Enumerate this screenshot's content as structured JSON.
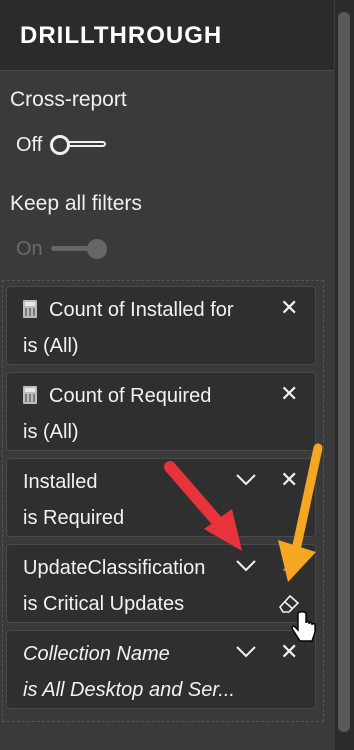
{
  "panel": {
    "title": "DRILLTHROUGH",
    "cross_report": {
      "label": "Cross-report",
      "toggle_text": "Off",
      "state": "off"
    },
    "keep_all_filters": {
      "label": "Keep all filters",
      "toggle_text": "On",
      "state": "on-disabled"
    }
  },
  "filters": [
    {
      "field": "Count of Installed for",
      "condition": "is (All)",
      "has_calc_icon": true,
      "italic": false,
      "controls": [
        "close"
      ]
    },
    {
      "field": "Count of Required",
      "condition": "is (All)",
      "has_calc_icon": true,
      "italic": false,
      "controls": [
        "close"
      ]
    },
    {
      "field": "Installed",
      "condition": "is Required",
      "has_calc_icon": false,
      "italic": false,
      "controls": [
        "chevron",
        "close"
      ]
    },
    {
      "field": "UpdateClassification",
      "condition": "is Critical Updates",
      "has_calc_icon": false,
      "italic": false,
      "controls": [
        "chevron",
        "close",
        "eraser"
      ]
    },
    {
      "field": "Collection Name",
      "condition": "is All Desktop and Ser...",
      "has_calc_icon": false,
      "italic": true,
      "controls": [
        "chevron",
        "close"
      ]
    }
  ],
  "icons": {
    "close": "close-icon",
    "chevron": "chevron-down-icon",
    "eraser": "eraser-icon",
    "calculator": "calculator-icon"
  },
  "colors": {
    "annotation_red": "#e8323c",
    "annotation_orange": "#f5a623"
  }
}
